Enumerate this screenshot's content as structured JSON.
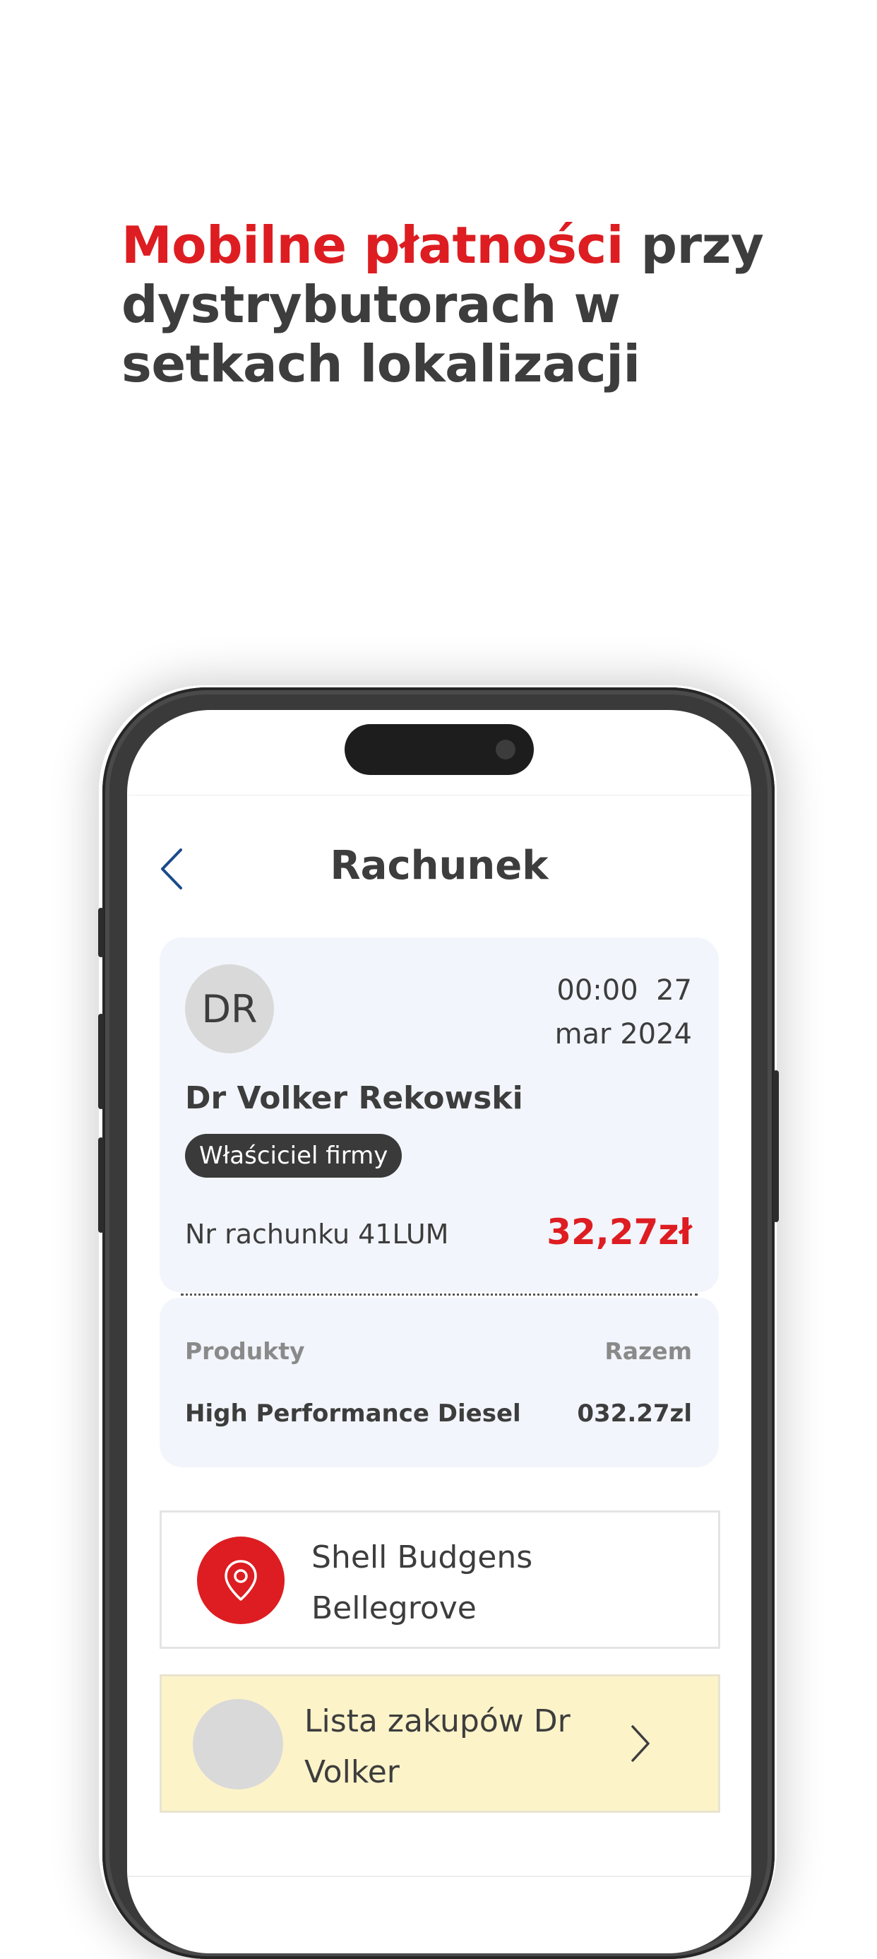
{
  "headline": {
    "accent": "Mobilne płatności",
    "rest": " przy dystrybutorach w setkach lokalizacji"
  },
  "header": {
    "title": "Rachunek",
    "back_icon": "chevron-left-icon"
  },
  "receipt": {
    "avatar_initials": "DR",
    "time": "00:00  27",
    "date": "mar 2024",
    "customer_name": "Dr Volker Rekowski",
    "role_badge": "Właściciel firmy",
    "receipt_number": "Nr rachunku 41LUM",
    "amount": "32,27zł",
    "columns": {
      "products": "Produkty",
      "total": "Razem"
    },
    "items": [
      {
        "name": "High Performance Diesel",
        "price": "032.27zl"
      }
    ]
  },
  "location": {
    "icon": "location-pin-icon",
    "name": "Shell Budgens Bellegrove"
  },
  "shopping_list": {
    "label": "Lista zakupów Dr Volker",
    "chevron_icon": "chevron-right-icon"
  },
  "colors": {
    "brand_red": "#dd1d21",
    "text_dark": "#3d3d3d",
    "card_bg": "#f2f5fb",
    "list_card_bg": "#fdf3c9",
    "back_icon": "#1a4a8a"
  }
}
